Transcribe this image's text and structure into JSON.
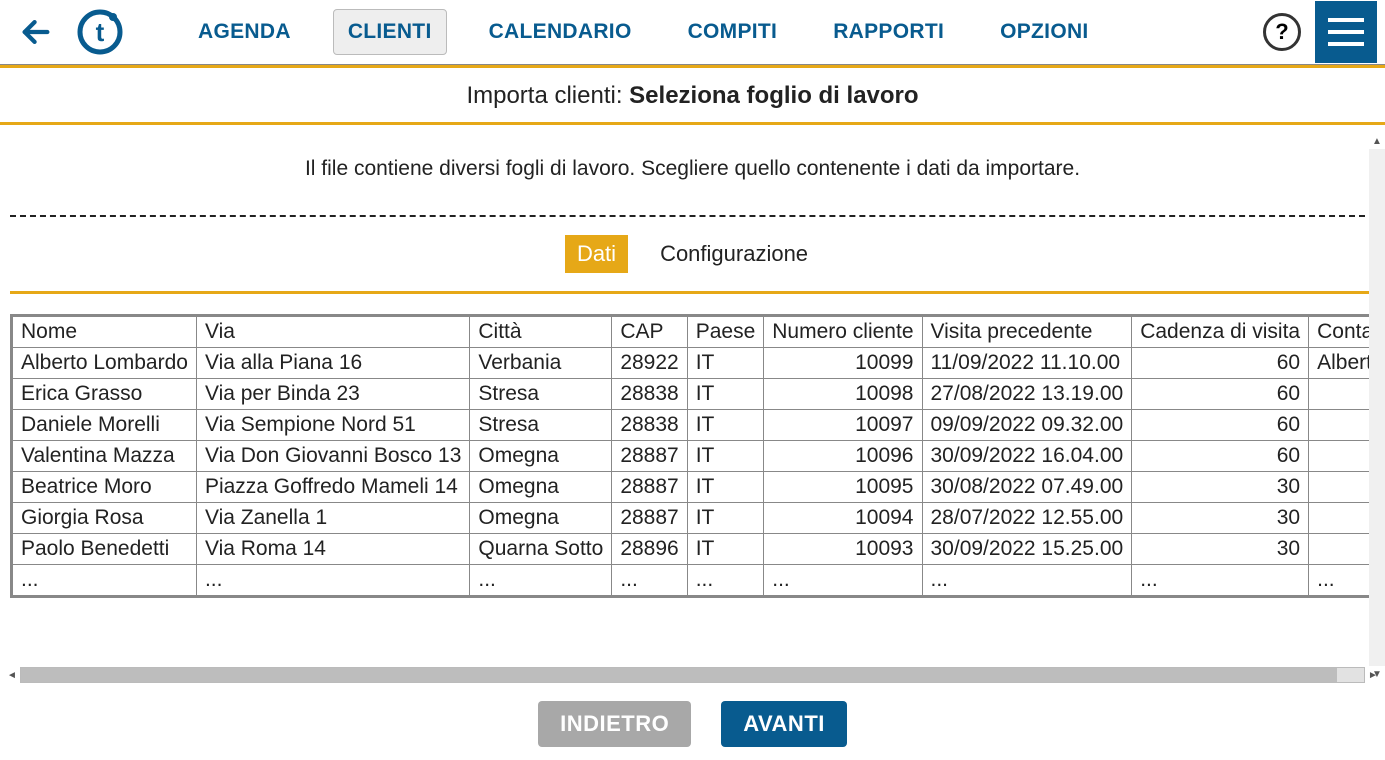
{
  "nav": {
    "tabs": [
      "AGENDA",
      "CLIENTI",
      "CALENDARIO",
      "COMPITI",
      "RAPPORTI",
      "OPZIONI"
    ],
    "active_index": 1
  },
  "title": {
    "prefix": "Importa clienti: ",
    "bold": "Seleziona foglio di lavoro"
  },
  "instruction": "Il file contiene diversi fogli di lavoro. Scegliere quello contenente i dati da importare.",
  "sheet_tabs": {
    "items": [
      "Dati",
      "Configurazione"
    ],
    "active_index": 0
  },
  "table": {
    "headers": [
      "Nome",
      "Via",
      "Città",
      "CAP",
      "Paese",
      "Numero cliente",
      "Visita precedente",
      "Cadenza di visita",
      "Contatto"
    ],
    "numeric_col_indices": [
      3,
      5,
      7
    ],
    "rows": [
      [
        "Alberto Lombardo",
        "Via alla Piana 16",
        "Verbania",
        "28922",
        "IT",
        "10099",
        "11/09/2022 11.10.00",
        "60",
        "Alberto Lo"
      ],
      [
        "Erica Grasso",
        "Via per Binda 23",
        "Stresa",
        "28838",
        "IT",
        "10098",
        "27/08/2022 13.19.00",
        "60",
        ""
      ],
      [
        "Daniele Morelli",
        "Via Sempione Nord 51",
        "Stresa",
        "28838",
        "IT",
        "10097",
        "09/09/2022 09.32.00",
        "60",
        ""
      ],
      [
        "Valentina Mazza",
        "Via Don Giovanni Bosco 13",
        "Omegna",
        "28887",
        "IT",
        "10096",
        "30/09/2022 16.04.00",
        "60",
        ""
      ],
      [
        "Beatrice Moro",
        "Piazza Goffredo Mameli 14",
        "Omegna",
        "28887",
        "IT",
        "10095",
        "30/08/2022 07.49.00",
        "30",
        ""
      ],
      [
        "Giorgia Rosa",
        "Via Zanella 1",
        "Omegna",
        "28887",
        "IT",
        "10094",
        "28/07/2022 12.55.00",
        "30",
        ""
      ],
      [
        "Paolo Benedetti",
        "Via Roma 14",
        "Quarna Sotto",
        "28896",
        "IT",
        "10093",
        "30/09/2022 15.25.00",
        "30",
        ""
      ],
      [
        "...",
        "...",
        "...",
        "...",
        "...",
        "...",
        "...",
        "...",
        "..."
      ]
    ]
  },
  "footer": {
    "back": "INDIETRO",
    "next": "AVANTI"
  },
  "help_glyph": "?"
}
